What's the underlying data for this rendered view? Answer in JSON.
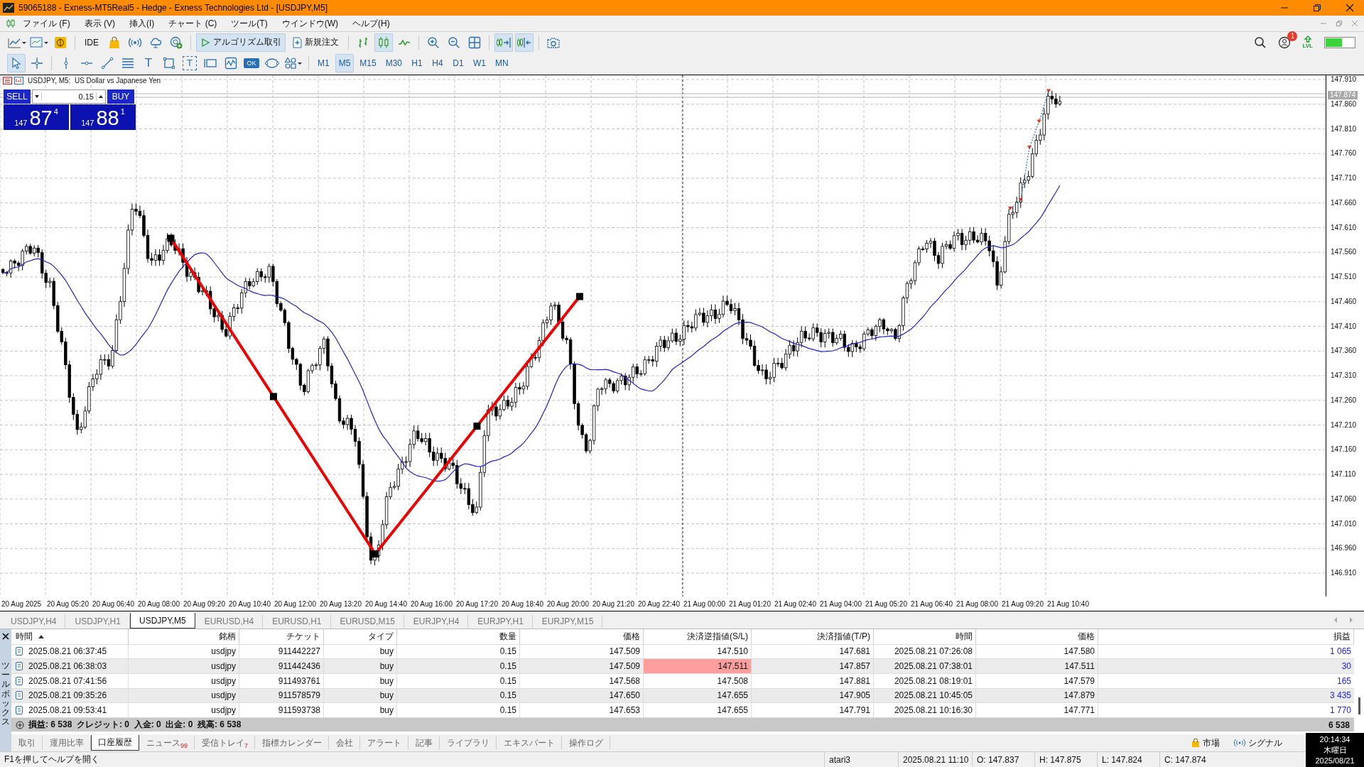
{
  "window": {
    "title": "59065188 - Exness-MT5Real5 - Hedge - Exness Technologies Ltd - [USDJPY,M5]"
  },
  "menu": [
    "ファイル (F)",
    "表示 (V)",
    "挿入(I)",
    "チャート (C)",
    "ツール(T)",
    "ウインドウ(W)",
    "ヘルプ(H)"
  ],
  "toolbar": {
    "ide": "IDE",
    "algo_trading": {
      "label": "アルゴリズム取引",
      "selected": true
    },
    "new_order": "新規注文",
    "chart_types": [
      {
        "selected": false
      },
      {
        "selected": true
      },
      {
        "selected": false
      }
    ],
    "auto_scroll": true,
    "chart_shift": true,
    "notification_count": "1",
    "lvl_label": "LVL"
  },
  "draw_tools": {
    "cursor": {
      "selected": true
    },
    "crosshair": {
      "selected": false
    },
    "text_tool": "T",
    "text_label_tool": "T",
    "button_tool": "OK"
  },
  "timeframes": [
    {
      "label": "M1",
      "selected": false
    },
    {
      "label": "M5",
      "selected": true
    },
    {
      "label": "M15",
      "selected": false
    },
    {
      "label": "M30",
      "selected": false
    },
    {
      "label": "H1",
      "selected": false
    },
    {
      "label": "H4",
      "selected": false
    },
    {
      "label": "D1",
      "selected": false
    },
    {
      "label": "W1",
      "selected": false
    },
    {
      "label": "MN",
      "selected": false
    }
  ],
  "chart": {
    "header": "USDJPY, M5:  US Dollar vs Japanese Yen",
    "trade_panel": {
      "sell_label": "SELL",
      "buy_label": "BUY",
      "volume": "0.15",
      "bid": {
        "big": "147",
        "pips": "87",
        "point": "4"
      },
      "ask": {
        "big": "147",
        "pips": "88",
        "point": "1"
      }
    },
    "price_tag": "147.874",
    "price_labels": [
      "147.910",
      "147.860",
      "147.810",
      "147.760",
      "147.710",
      "147.660",
      "147.610",
      "147.560",
      "147.510",
      "147.460",
      "147.410",
      "147.360",
      "147.310",
      "147.260",
      "147.210",
      "147.160",
      "147.110",
      "147.060",
      "147.010",
      "146.960",
      "146.910"
    ],
    "time_labels": [
      "20 Aug 2025",
      "20 Aug 05:20",
      "20 Aug 06:40",
      "20 Aug 08:00",
      "20 Aug 09:20",
      "20 Aug 10:40",
      "20 Aug 12:00",
      "20 Aug 13:20",
      "20 Aug 14:40",
      "20 Aug 16:00",
      "20 Aug 17:20",
      "20 Aug 18:40",
      "20 Aug 20:00",
      "20 Aug 21:20",
      "20 Aug 22:40",
      "21 Aug 00:00",
      "21 Aug 01:20",
      "21 Aug 02:40",
      "21 Aug 04:00",
      "21 Aug 05:20",
      "21 Aug 06:40",
      "21 Aug 08:00",
      "21 Aug 09:20",
      "21 Aug 10:40"
    ]
  },
  "chart_tabs": [
    {
      "label": "USDJPY,H4",
      "selected": false
    },
    {
      "label": "USDJPY,H1",
      "selected": false
    },
    {
      "label": "USDJPY,M5",
      "selected": true
    },
    {
      "label": "EURUSD,H4",
      "selected": false
    },
    {
      "label": "EURUSD,H1",
      "selected": false
    },
    {
      "label": "EURUSD,M15",
      "selected": false
    },
    {
      "label": "EURJPY,H4",
      "selected": false
    },
    {
      "label": "EURJPY,H1",
      "selected": false
    },
    {
      "label": "EURJPY,M15",
      "selected": false
    }
  ],
  "toolbox": {
    "title": "ツールボックス",
    "columns": [
      "時間",
      "銘柄",
      "チケット",
      "タイプ",
      "数量",
      "価格",
      "決済逆指値(S/L)",
      "決済指値(T/P)",
      "時間",
      "価格",
      "損益"
    ],
    "rows": [
      {
        "time": "2025.08.21 06:37:45",
        "symbol": "usdjpy",
        "ticket": "911442227",
        "type": "buy",
        "volume": "0.15",
        "price": "147.509",
        "sl": "147.510",
        "tp": "147.681",
        "close_time": "2025.08.21 07:26:08",
        "close_price": "147.580",
        "profit": "1 065",
        "sl_highlight": false
      },
      {
        "time": "2025.08.21 06:38:03",
        "symbol": "usdjpy",
        "ticket": "911442436",
        "type": "buy",
        "volume": "0.15",
        "price": "147.509",
        "sl": "147.511",
        "tp": "147.857",
        "close_time": "2025.08.21 07:38:01",
        "close_price": "147.511",
        "profit": "30",
        "sl_highlight": true
      },
      {
        "time": "2025.08.21 07:41:56",
        "symbol": "usdjpy",
        "ticket": "911493761",
        "type": "buy",
        "volume": "0.15",
        "price": "147.568",
        "sl": "147.508",
        "tp": "147.881",
        "close_time": "2025.08.21 08:19:01",
        "close_price": "147.579",
        "profit": "165",
        "sl_highlight": false
      },
      {
        "time": "2025.08.21 09:35:26",
        "symbol": "usdjpy",
        "ticket": "911578579",
        "type": "buy",
        "volume": "0.15",
        "price": "147.650",
        "sl": "147.655",
        "tp": "147.905",
        "close_time": "2025.08.21 10:45:05",
        "close_price": "147.879",
        "profit": "3 435",
        "sl_highlight": false
      },
      {
        "time": "2025.08.21 09:53:41",
        "symbol": "usdjpy",
        "ticket": "911593738",
        "type": "buy",
        "volume": "0.15",
        "price": "147.653",
        "sl": "147.655",
        "tp": "147.791",
        "close_time": "2025.08.21 10:16:30",
        "close_price": "147.771",
        "profit": "1 770",
        "sl_highlight": false
      }
    ],
    "summary": "損益: 6 538  クレジット: 0  入金: 0  出金: 0  残高: 6 538",
    "summary_total": "6 538",
    "tabs": [
      {
        "label": "取引",
        "selected": false
      },
      {
        "label": "運用比率",
        "selected": false
      },
      {
        "label": "口座履歴",
        "selected": true
      },
      {
        "label": "ニュース",
        "badge": "99",
        "selected": false
      },
      {
        "label": "受信トレイ",
        "badge": "7",
        "selected": false
      },
      {
        "label": "指標カレンダー",
        "selected": false
      },
      {
        "label": "会社",
        "selected": false
      },
      {
        "label": "アラート",
        "selected": false
      },
      {
        "label": "記事",
        "selected": false
      },
      {
        "label": "ライブラリ",
        "selected": false
      },
      {
        "label": "エキスパート",
        "selected": false
      },
      {
        "label": "操作ログ",
        "selected": false
      }
    ],
    "links": [
      "市場",
      "シグナル"
    ]
  },
  "status_bar": {
    "hint": "F1を押してヘルプを開く",
    "profile": "atari3",
    "time": "2025.08.21 11:10",
    "open": "O: 147.837",
    "high": "H: 147.875",
    "low": "L: 147.824",
    "close": "C: 147.874"
  },
  "clock": {
    "time": "20:14:34",
    "weekday": "木曜日",
    "date": "2025/08/21"
  }
}
